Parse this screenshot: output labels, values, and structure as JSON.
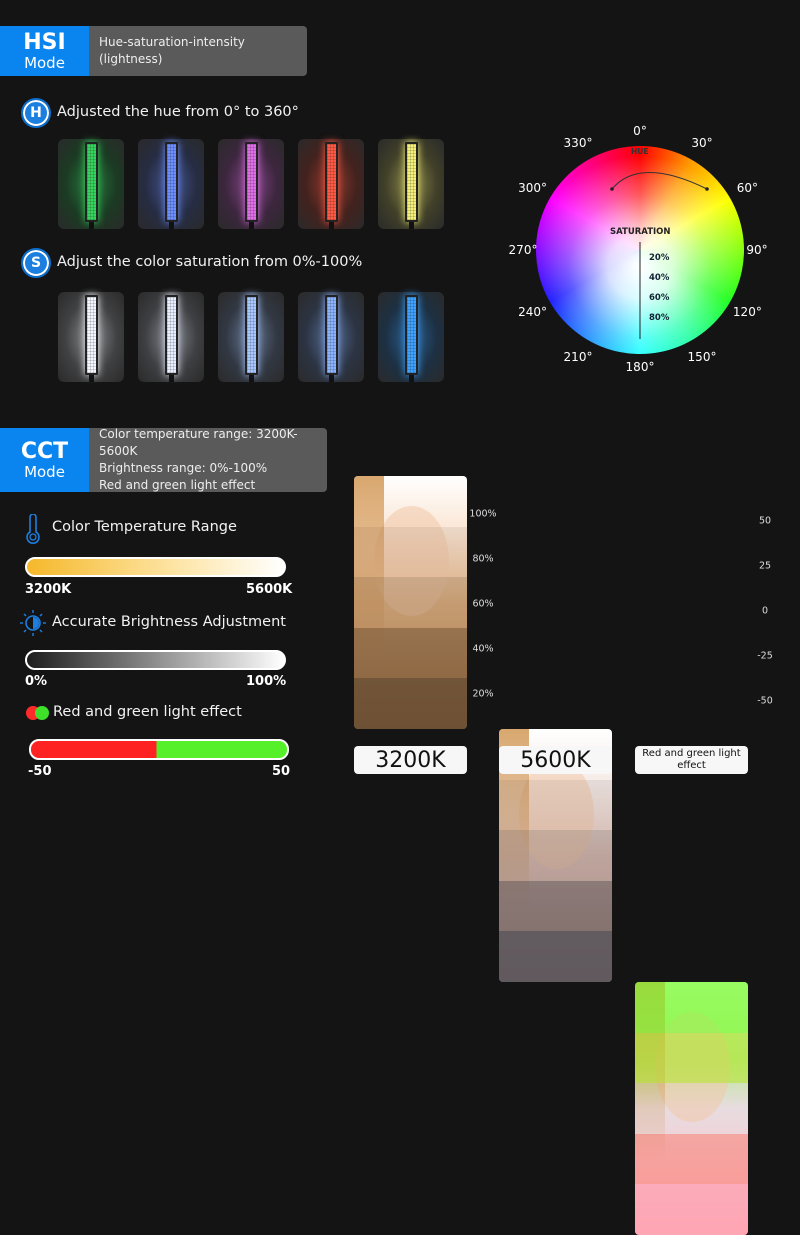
{
  "hsi": {
    "title": "HSI",
    "mode": "Mode",
    "description": "Hue-saturation-intensity (lightness)",
    "hue": {
      "icon_letter": "H",
      "label": "Adjusted the hue from 0° to 360°",
      "colors": [
        "#38d460",
        "#6f8fff",
        "#e070e8",
        "#ff5a45",
        "#f5f07a"
      ]
    },
    "saturation": {
      "icon_letter": "S",
      "label": "Adjust the color saturation from 0%-100%",
      "colors": [
        "#f4f7ff",
        "#e8efff",
        "#a9c8ff",
        "#8cb4ff",
        "#3fa2ff"
      ]
    }
  },
  "wheel": {
    "hue_label": "HUE",
    "saturation_label": "SATURATION",
    "saturation_ticks": [
      "20%",
      "40%",
      "60%",
      "80%"
    ],
    "degrees": [
      "0°",
      "30°",
      "60°",
      "90°",
      "120°",
      "150°",
      "180°",
      "210°",
      "240°",
      "270°",
      "300°",
      "330°"
    ]
  },
  "cct": {
    "title": "CCT",
    "mode": "Mode",
    "description": [
      "Color temperature range: 3200K-5600K",
      "Brightness range: 0%-100%",
      "Red and green light effect"
    ],
    "temperature": {
      "label": "Color Temperature Range",
      "min": "3200K",
      "max": "5600K"
    },
    "brightness": {
      "label": "Accurate Brightness Adjustment",
      "min": "0%",
      "max": "100%"
    },
    "redgreen": {
      "label": "Red and green  light effect",
      "min": "-50",
      "max": "50",
      "red": "#ff2222",
      "green": "#55f02a"
    }
  },
  "photos": {
    "captions": [
      "3200K",
      "5600K",
      "Red and green light effect"
    ],
    "brightness_scale": [
      "100%",
      "80%",
      "60%",
      "40%",
      "20%"
    ],
    "redgreen_scale": [
      "50",
      "25",
      "0",
      "-25",
      "-50"
    ]
  }
}
